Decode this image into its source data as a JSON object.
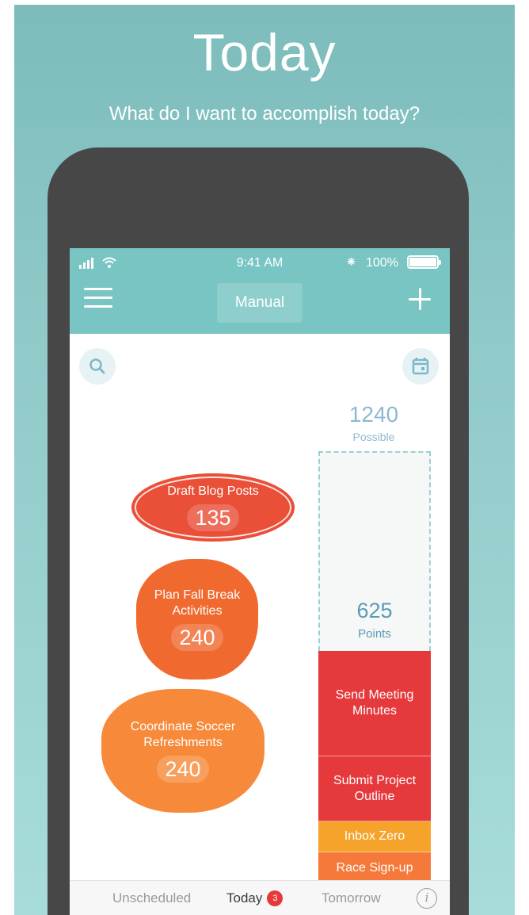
{
  "poster": {
    "title": "Today",
    "subtitle": "What do I want to accomplish today?"
  },
  "status_bar": {
    "time": "9:41 AM",
    "battery": "100%"
  },
  "header": {
    "mode_label": "Manual"
  },
  "capacity": {
    "possible_value": "1240",
    "possible_label": "Possible",
    "points_value": "625",
    "points_label": "Points"
  },
  "stack": [
    {
      "label": "Send Meeting Minutes",
      "color": "#e5393c"
    },
    {
      "label": "Submit Project Outline",
      "color": "#e5393c"
    },
    {
      "label": "Inbox Zero",
      "color": "#f5a32a"
    },
    {
      "label": "Race Sign-up",
      "color": "#f5793a"
    }
  ],
  "tasks": [
    {
      "title": "Draft Blog Posts",
      "points": "135",
      "color": "#ea4f38"
    },
    {
      "title": "Plan Fall Break Activities",
      "points": "240",
      "color": "#f06a30"
    },
    {
      "title": "Coordinate Soccer Refreshments",
      "points": "240",
      "color": "#f78a3a"
    }
  ],
  "tabs": {
    "unscheduled": "Unscheduled",
    "today": "Today",
    "today_badge": "3",
    "tomorrow": "Tomorrow",
    "info": "i"
  },
  "colors": {
    "accent": "#79c5c4",
    "phone_body": "#474747"
  },
  "icons": {
    "menu": "hamburger-icon",
    "add": "plus-icon",
    "search": "search-icon",
    "calendar": "calendar-icon",
    "info": "info-icon"
  }
}
